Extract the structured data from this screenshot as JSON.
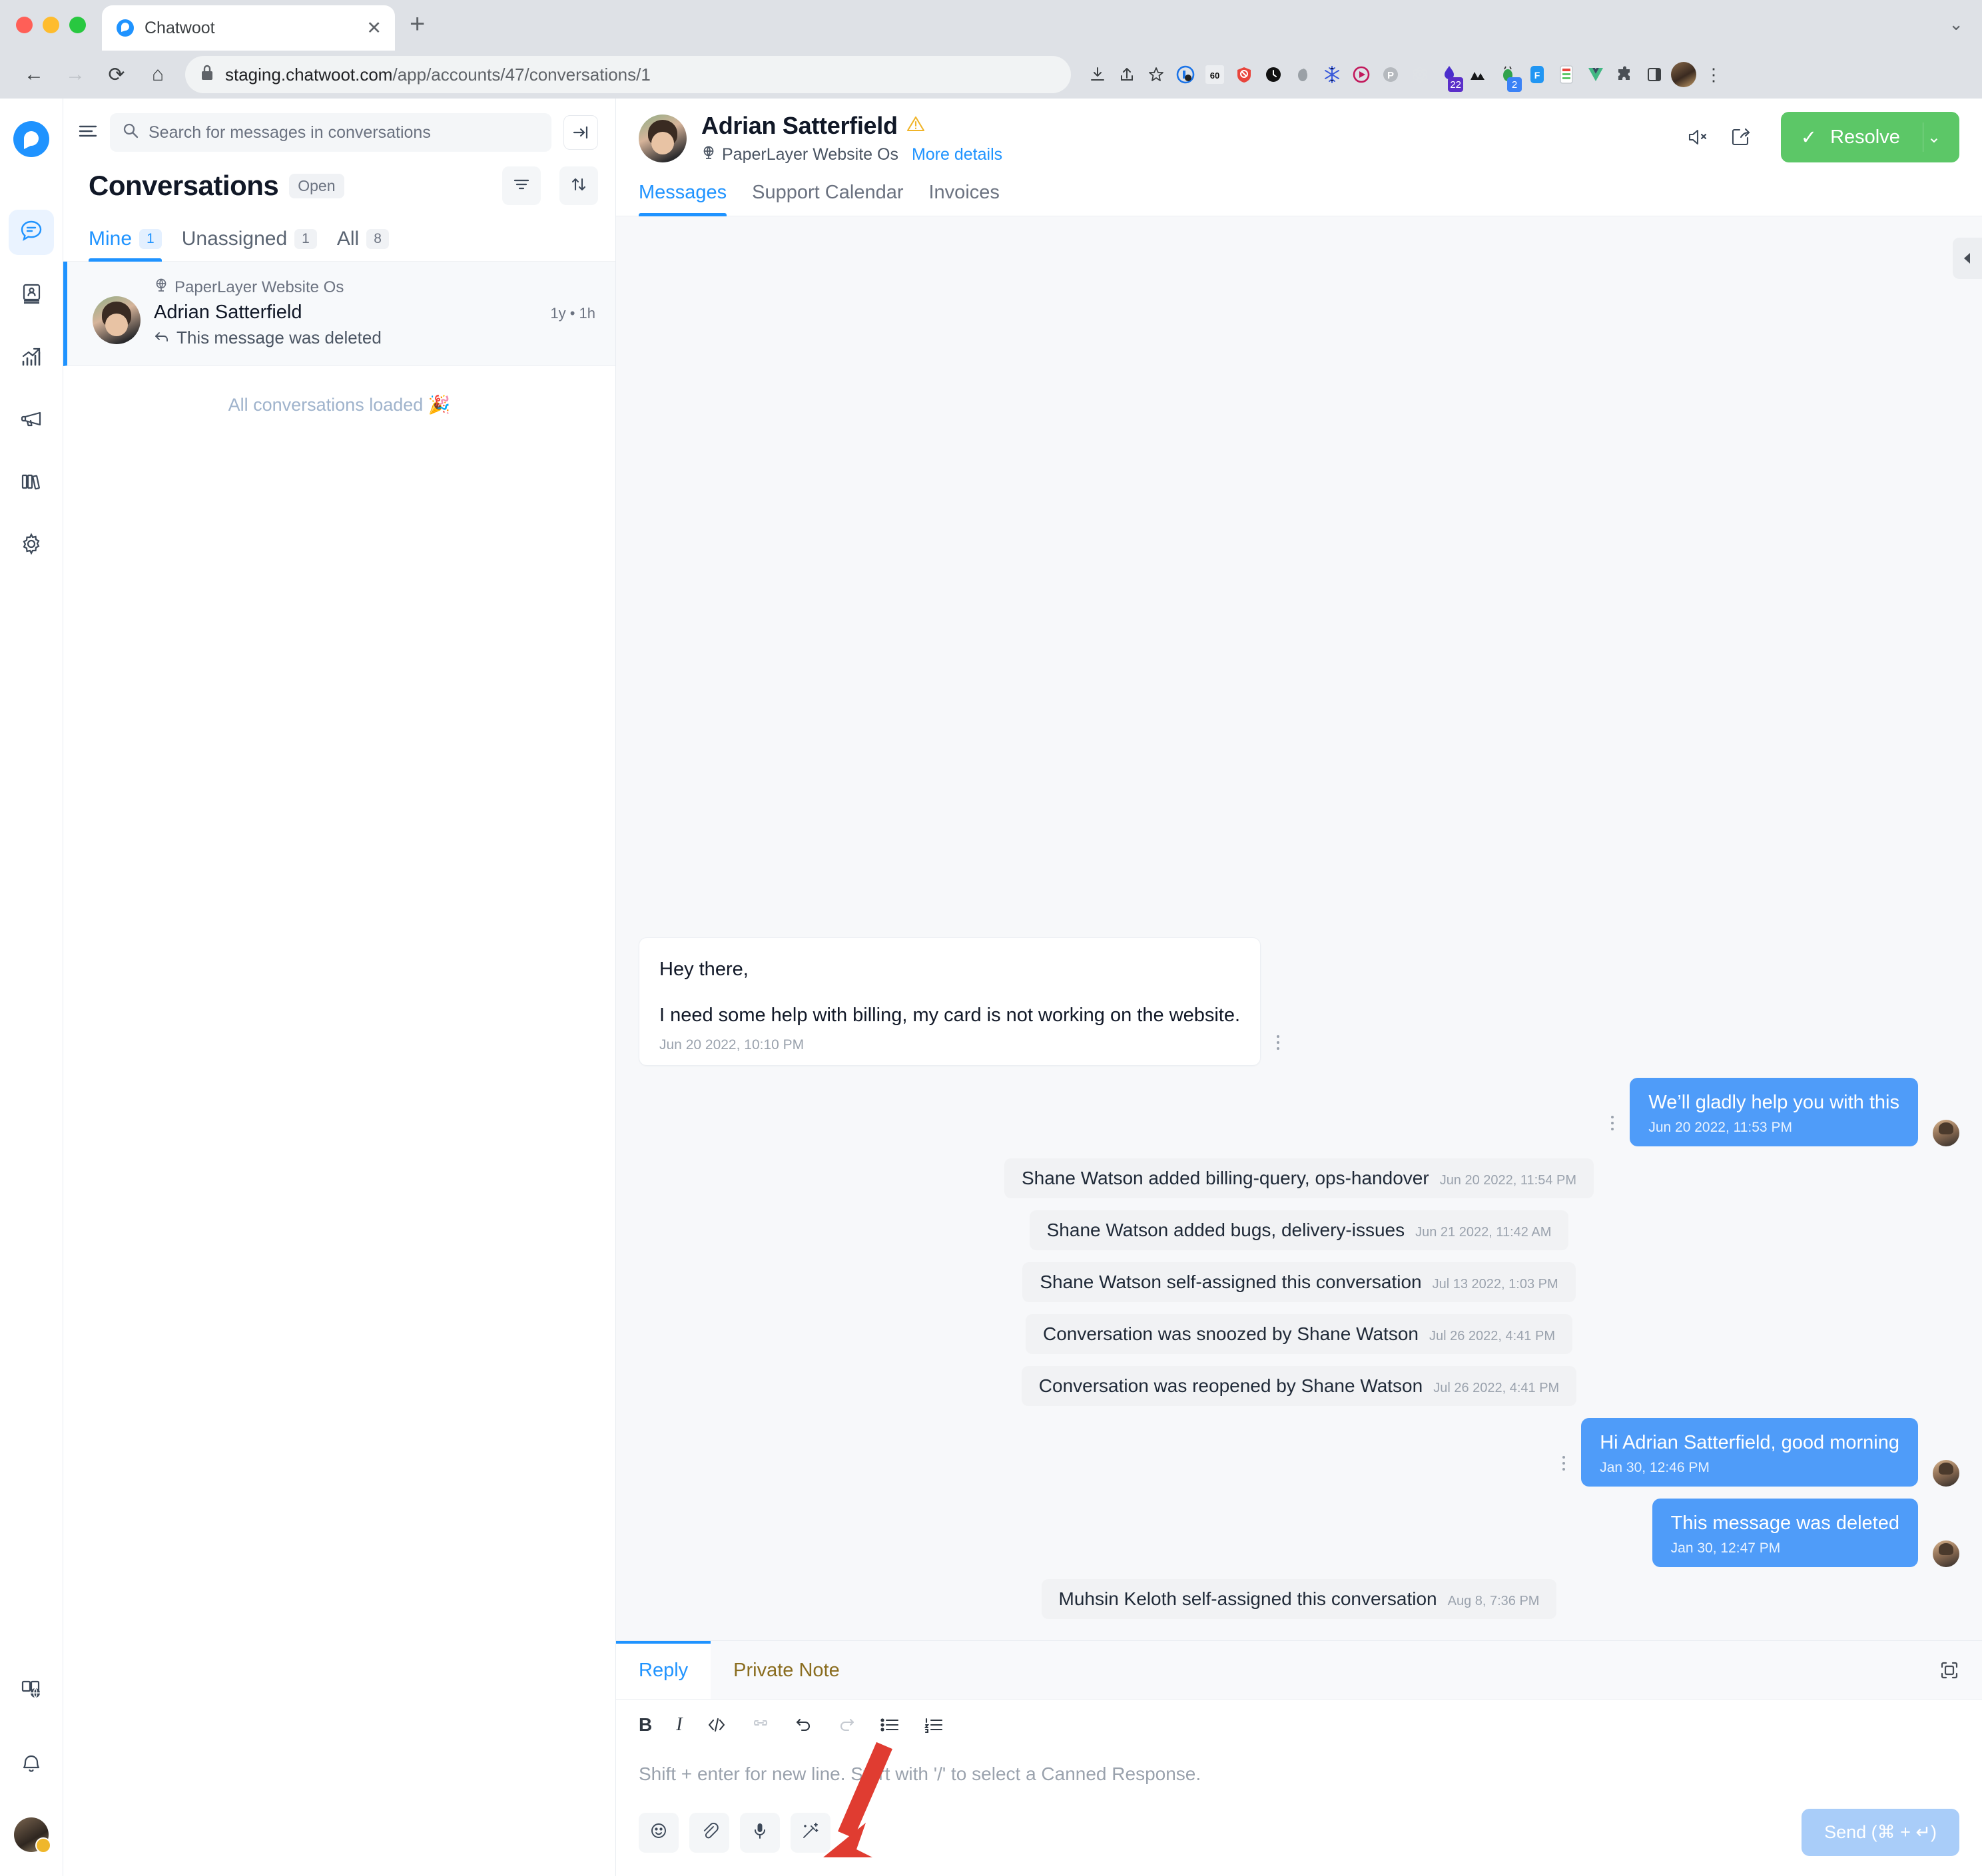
{
  "browser": {
    "tab_title": "Chatwoot",
    "tab_close_label": "✕",
    "new_tab_label": "+",
    "tabstrip_collapse_label": "⌄",
    "back_label": "←",
    "forward_label": "→",
    "reload_label": "⟳",
    "home_label": "⌂",
    "lock_label": "🔒",
    "url_domain": "staging.chatwoot.com",
    "url_path": "/app/accounts/47/conversations/1",
    "menu_label": "⋮",
    "extension_badges": {
      "purple": "22",
      "blue": "2"
    }
  },
  "rail": {
    "brand_name": "chatwoot-logo",
    "items": [
      {
        "name": "conversations",
        "icon": "chat-bubble-icon",
        "active": true
      },
      {
        "name": "contacts",
        "icon": "contact-book-icon",
        "active": false
      },
      {
        "name": "reports",
        "icon": "trending-up-chart-icon",
        "active": false
      },
      {
        "name": "campaigns",
        "icon": "megaphone-icon",
        "active": false
      },
      {
        "name": "help-center",
        "icon": "books-icon",
        "active": false
      },
      {
        "name": "settings",
        "icon": "gear-icon",
        "active": false
      }
    ],
    "bottom": [
      {
        "name": "docs",
        "icon": "book-globe-icon"
      },
      {
        "name": "notifications",
        "icon": "bell-icon"
      },
      {
        "name": "profile",
        "icon": "avatar"
      }
    ]
  },
  "conversations": {
    "search_placeholder": "Search for messages in conversations",
    "search_value": "",
    "collapse_label": "→|",
    "title": "Conversations",
    "status_chip": "Open",
    "filter_icon": "filter-icon",
    "sort_icon": "sort-icon",
    "tabs": [
      {
        "label": "Mine",
        "count": "1",
        "active": true
      },
      {
        "label": "Unassigned",
        "count": "1",
        "active": false
      },
      {
        "label": "All",
        "count": "8",
        "active": false
      }
    ],
    "items": [
      {
        "inbox": "PaperLayer Website Os",
        "name": "Adrian Satterfield",
        "time": "1y • 1h",
        "preview": "This message was deleted",
        "preview_prefix_icon": "reply-arrow-icon"
      }
    ],
    "footer_note": "All conversations loaded 🎉"
  },
  "header": {
    "contact_name": "Adrian Satterfield",
    "warning_icon": "warning-triangle-icon",
    "inbox_name": "PaperLayer Website Os",
    "more_details": "More details",
    "mute_icon": "mute-speaker-icon",
    "share_icon": "share-box-icon",
    "resolve_label": "Resolve",
    "resolve_check": "✓",
    "resolve_caret": "⌄",
    "tabs": [
      {
        "label": "Messages",
        "active": true
      },
      {
        "label": "Support Calendar",
        "active": false
      },
      {
        "label": "Invoices",
        "active": false
      }
    ]
  },
  "panel_toggle_icon": "collapse-left-arrow-icon",
  "messages": [
    {
      "type": "incoming",
      "lines": [
        "Hey there,",
        "I need some help with billing, my card is not working on the website."
      ],
      "timestamp": "Jun 20 2022, 10:10 PM",
      "has_menu": true
    },
    {
      "type": "outgoing",
      "text": "We’ll gladly help you with this",
      "timestamp": "Jun 20 2022, 11:53 PM",
      "has_menu": true,
      "has_avatar": true
    },
    {
      "type": "activity",
      "text": "Shane Watson added billing-query, ops-handover",
      "timestamp": "Jun 20 2022, 11:54 PM"
    },
    {
      "type": "activity",
      "text": "Shane Watson added bugs, delivery-issues",
      "timestamp": "Jun 21 2022, 11:42 AM"
    },
    {
      "type": "activity",
      "text": "Shane Watson self-assigned this conversation",
      "timestamp": "Jul 13 2022, 1:03 PM"
    },
    {
      "type": "activity",
      "text": "Conversation was snoozed by Shane Watson",
      "timestamp": "Jul 26 2022, 4:41 PM"
    },
    {
      "type": "activity",
      "text": "Conversation was reopened by Shane Watson",
      "timestamp": "Jul 26 2022, 4:41 PM"
    },
    {
      "type": "outgoing",
      "text": "Hi Adrian Satterfield, good morning",
      "timestamp": "Jan 30, 12:46 PM",
      "has_menu": true,
      "has_avatar": true
    },
    {
      "type": "outgoing",
      "text": "This message was deleted",
      "timestamp": "Jan 30, 12:47 PM",
      "has_menu": false,
      "has_avatar": true
    },
    {
      "type": "activity",
      "text": "Muhsin Keloth self-assigned this conversation",
      "timestamp": "Aug 8, 7:36 PM"
    }
  ],
  "composer": {
    "tabs": [
      {
        "label": "Reply",
        "active": true
      },
      {
        "label": "Private Note",
        "active": false
      }
    ],
    "expand_icon": "expand-fullscreen-icon",
    "format_buttons": [
      {
        "name": "bold-button",
        "glyph": "B"
      },
      {
        "name": "italic-button",
        "glyph": "I"
      },
      {
        "name": "code-button",
        "glyph": "‹›"
      },
      {
        "name": "link-button",
        "glyph": "⚭"
      },
      {
        "name": "undo-button",
        "glyph": "↶"
      },
      {
        "name": "redo-button",
        "glyph": "↷"
      },
      {
        "name": "bullet-list-button",
        "glyph": "☰"
      },
      {
        "name": "ordered-list-button",
        "glyph": "☷"
      }
    ],
    "placeholder": "Shift + enter for new line. Start with '/' to select a Canned Response.",
    "value": "",
    "tools": [
      {
        "name": "emoji-button",
        "icon": "smiley-icon"
      },
      {
        "name": "attach-button",
        "icon": "paperclip-icon"
      },
      {
        "name": "audio-button",
        "icon": "microphone-icon"
      },
      {
        "name": "ai-assist-button",
        "icon": "magic-wand-icon"
      }
    ],
    "send_label": "Send (⌘ + ↵)"
  },
  "annotation": {
    "arrow_color": "#e03c31",
    "points_to": "ai-assist-button"
  }
}
